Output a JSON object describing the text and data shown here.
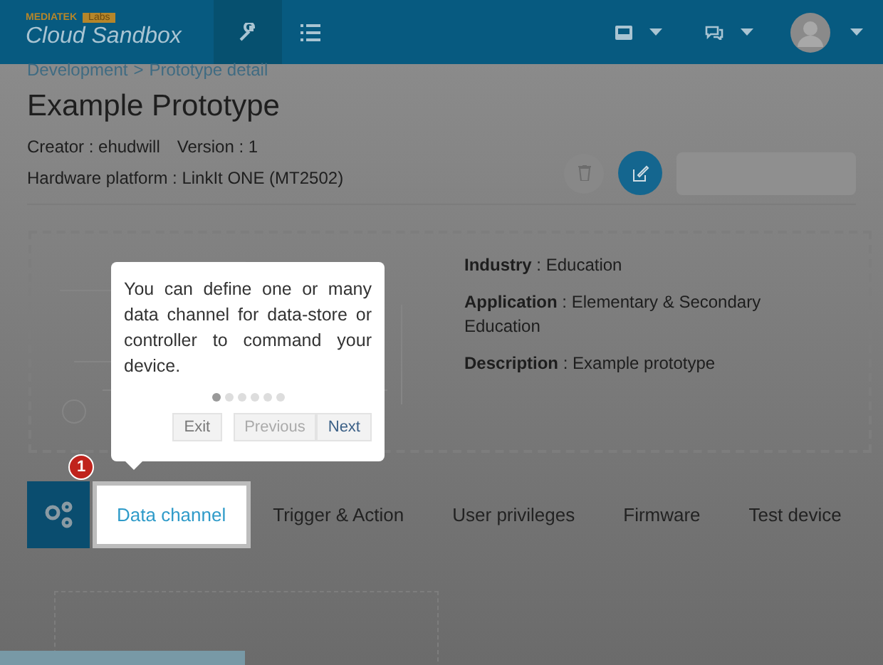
{
  "header": {
    "brand": "MEDIATEK",
    "brand_badge": "Labs",
    "product": "Cloud Sandbox"
  },
  "breadcrumb": [
    {
      "label": "Development"
    },
    {
      "label": "Prototype detail"
    }
  ],
  "breadcrumb_separator": ">",
  "title": "Example Prototype",
  "meta": [
    {
      "label": "Creator : ehudwill"
    },
    {
      "label": "Version : 1"
    }
  ],
  "platform": "Hardware platform : LinkIt ONE (MT2502)",
  "details": [
    {
      "label": "Industry",
      "value": " : Education"
    },
    {
      "label": "Application",
      "value": " : Elementary & Secondary Education"
    },
    {
      "label": "Description",
      "value": " : Example prototype"
    }
  ],
  "tour": {
    "text": "You can define one or many data channel for data-store or controller to command your device.",
    "steps": [
      {
        "selected": true
      },
      {
        "selected": false
      },
      {
        "selected": false
      },
      {
        "selected": false
      },
      {
        "selected": false
      },
      {
        "selected": false
      }
    ],
    "buttons": [
      {
        "label": "Exit",
        "disabled": false
      },
      {
        "label": "Previous",
        "disabled": true
      },
      {
        "label": "Next",
        "disabled": false
      }
    ],
    "badge": "1"
  },
  "tabs": [
    {
      "label": "Data channel",
      "selected": true
    },
    {
      "label": "Trigger & Action",
      "selected": false
    },
    {
      "label": "User privileges",
      "selected": false
    },
    {
      "label": "Firmware",
      "selected": false
    },
    {
      "label": "Test device",
      "selected": false
    }
  ]
}
